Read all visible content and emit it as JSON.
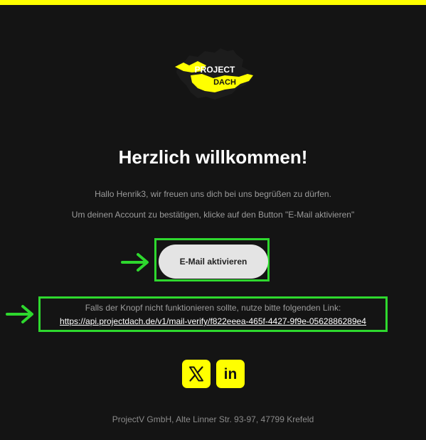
{
  "brand": {
    "accent_color": "#ffff00",
    "highlight_color": "#2ed82e",
    "logo_line1": "PROJECT",
    "logo_line2": "DACH"
  },
  "email": {
    "title": "Herzlich willkommen!",
    "greeting": "Hallo Henrik3, wir freuen uns dich bei uns begrüßen zu dürfen.",
    "instruction": "Um deinen Account zu bestätigen, klicke auf den Button \"E-Mail aktivieren\"",
    "button_label": "E-Mail aktivieren",
    "fallback_text": "Falls der Knopf nicht funktionieren sollte, nutze bitte folgenden Link:",
    "verify_link": "https://api.projectdach.de/v1/mail-verify/f822eeea-465f-4427-9f9e-0562886289e4"
  },
  "social": {
    "x_icon": "x-icon",
    "linkedin_icon": "linkedin-icon",
    "linkedin_text": "in"
  },
  "footer": {
    "address": "ProjectV GmbH, Alte Linner Str. 93-97, 47799 Krefeld"
  }
}
